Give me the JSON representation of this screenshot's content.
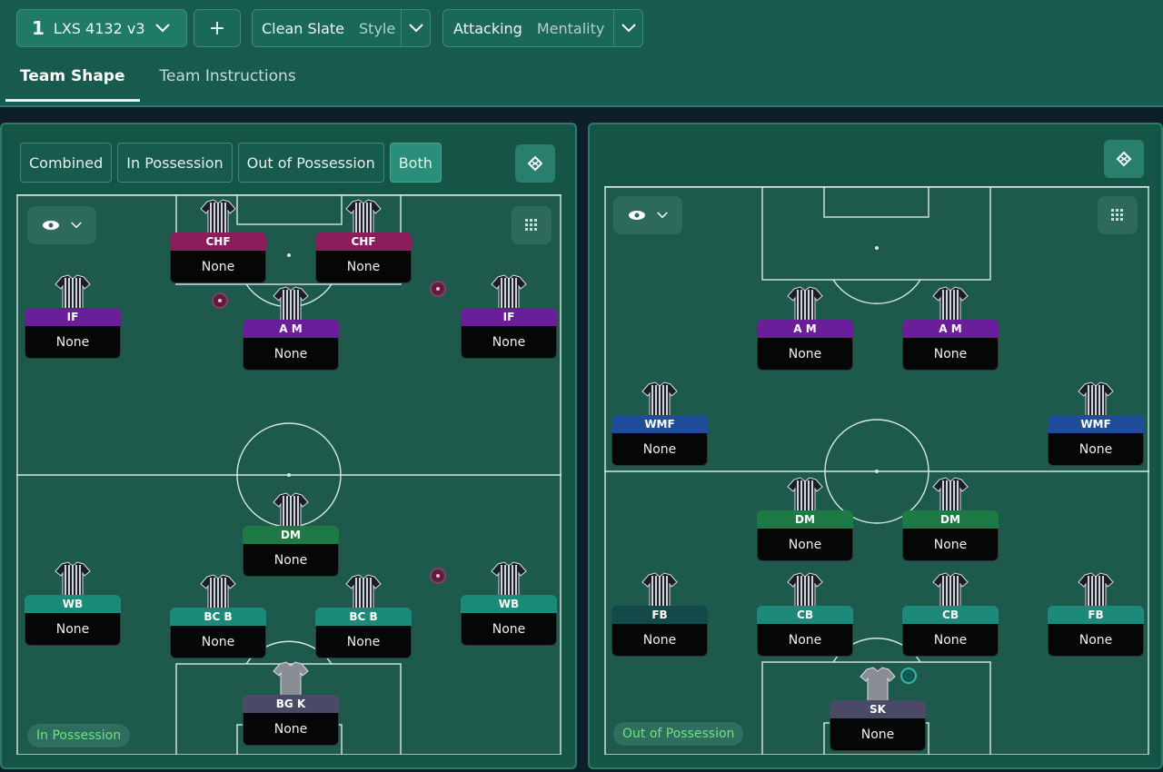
{
  "header": {
    "tactic_number": "1",
    "tactic_name": "LXS 4132 v3",
    "add_label": "+",
    "style_value": "Clean Slate",
    "style_label": "Style",
    "mentality_value": "Attacking",
    "mentality_label": "Mentality"
  },
  "tabs": {
    "team_shape": "Team Shape",
    "team_instructions": "Team Instructions"
  },
  "left_panel": {
    "segments": [
      "Combined",
      "In Possession",
      "Out of Possession",
      "Both"
    ],
    "phase_label": "In Possession"
  },
  "right_panel": {
    "phase_label": "Out of Possession"
  },
  "left_players": [
    {
      "role": "CHF",
      "duty": "None",
      "color": "#8c1d5c"
    },
    {
      "role": "CHF",
      "duty": "None",
      "color": "#8c1d5c"
    },
    {
      "role": "IF",
      "duty": "None",
      "color": "#6a1e9a"
    },
    {
      "role": "A M",
      "duty": "None",
      "color": "#6a1e9a"
    },
    {
      "role": "IF",
      "duty": "None",
      "color": "#6a1e9a"
    },
    {
      "role": "DM",
      "duty": "None",
      "color": "#1d7a45"
    },
    {
      "role": "WB",
      "duty": "None",
      "color": "#1b8a7a"
    },
    {
      "role": "BC B",
      "duty": "None",
      "color": "#1b8a7a"
    },
    {
      "role": "BC B",
      "duty": "None",
      "color": "#1b8a7a"
    },
    {
      "role": "WB",
      "duty": "None",
      "color": "#1b8a7a"
    },
    {
      "role": "BG K",
      "duty": "None",
      "color": "#4a4a66"
    }
  ],
  "right_players": [
    {
      "role": "A M",
      "duty": "None",
      "color": "#6a1e9a"
    },
    {
      "role": "A M",
      "duty": "None",
      "color": "#6a1e9a"
    },
    {
      "role": "WMF",
      "duty": "None",
      "color": "#1f4d9a"
    },
    {
      "role": "WMF",
      "duty": "None",
      "color": "#1f4d9a"
    },
    {
      "role": "DM",
      "duty": "None",
      "color": "#1d7a45"
    },
    {
      "role": "DM",
      "duty": "None",
      "color": "#1d7a45"
    },
    {
      "role": "FB",
      "duty": "None",
      "color": "#124a4a"
    },
    {
      "role": "CB",
      "duty": "None",
      "color": "#1b8a7a"
    },
    {
      "role": "CB",
      "duty": "None",
      "color": "#1b8a7a"
    },
    {
      "role": "FB",
      "duty": "None",
      "color": "#1b8a7a"
    },
    {
      "role": "SK",
      "duty": "None",
      "color": "#4a4a66"
    }
  ]
}
